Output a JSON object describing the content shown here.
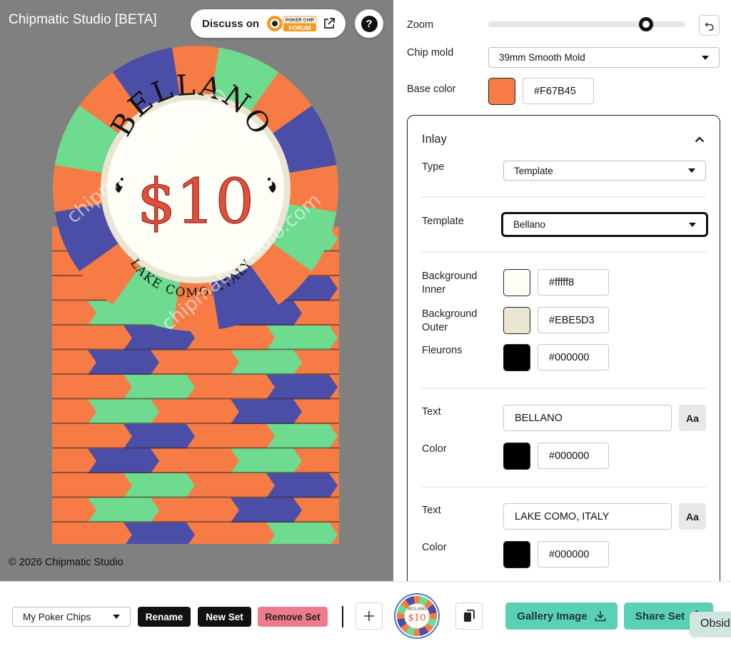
{
  "app": {
    "title": "Chipmatic Studio [BETA]",
    "discuss_label": "Discuss on",
    "forum_logo_lines": [
      "POKER CHIP",
      "FORUM"
    ],
    "help_label": "?",
    "copyright": "© 2026 Chipmatic Studio"
  },
  "chip": {
    "brand": "BELLANO",
    "value": "$10",
    "location": "LAKE COMO, ITALY",
    "watermark": "chipmaticstudio.com",
    "colors": {
      "base": "#F67B45",
      "spot_blue": "#4A4EA6",
      "spot_green": "#6EDB8F",
      "inlay_inner": "#fffff8",
      "inlay_outer": "#EBE5D3",
      "value_red": "#E24E3A"
    }
  },
  "zoom": {
    "label": "Zoom",
    "level": 0.8
  },
  "chip_mold": {
    "label": "Chip mold",
    "value": "39mm Smooth Mold"
  },
  "base_color": {
    "label": "Base color",
    "hex": "#F67B45"
  },
  "inlay": {
    "title": "Inlay",
    "type": {
      "label": "Type",
      "value": "Template"
    },
    "template": {
      "label": "Template",
      "value": "Bellano"
    },
    "background_inner": {
      "label_line1": "Background",
      "label_line2": "Inner",
      "hex": "#fffff8"
    },
    "background_outer": {
      "label_line1": "Background",
      "label_line2": "Outer",
      "hex": "#EBE5D3"
    },
    "fleurons": {
      "label": "Fleurons",
      "hex": "#000000"
    },
    "text1": {
      "label": "Text",
      "value": "BELLANO",
      "font_button": "Aa",
      "color_label": "Color",
      "color_hex": "#000000"
    },
    "text2": {
      "label": "Text",
      "value": "LAKE COMO, ITALY",
      "font_button": "Aa",
      "color_label": "Color",
      "color_hex": "#000000"
    }
  },
  "bottom_bar": {
    "set_name": "My Poker Chips",
    "rename_label": "Rename",
    "new_set_label": "New Set",
    "remove_set_label": "Remove Set",
    "add_label": "+",
    "gallery_image_label": "Gallery Image",
    "share_set_label": "Share Set",
    "tooltip_text": "Obsid"
  },
  "icons": {
    "forum_logo": "poker-chip-forum-logo",
    "external_link": "external-link-icon",
    "help": "help-icon",
    "undo": "undo-icon",
    "chevron_up": "chevron-up-icon",
    "download": "download-icon",
    "share": "share-icon",
    "copy": "copy-icon",
    "plus": "plus-icon"
  }
}
